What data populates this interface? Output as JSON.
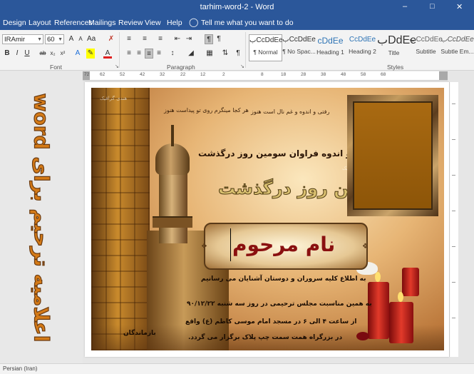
{
  "window": {
    "title": "tarhim-word-2  -  Word"
  },
  "tabs": [
    "Design",
    "Layout",
    "References",
    "Mailings",
    "Review",
    "View",
    "Help"
  ],
  "tell_me": {
    "placeholder": "Tell me what you want to do"
  },
  "font": {
    "name": "IRAmir",
    "size": "60"
  },
  "groups": {
    "font": "Font",
    "paragraph": "Paragraph",
    "styles": "Styles"
  },
  "styles": [
    {
      "preview": "بCcDdEe",
      "name": "¶ Normal"
    },
    {
      "preview": "بCcDdEe",
      "name": "¶ No Spac..."
    },
    {
      "preview": "cDdEe",
      "name": "Heading 1"
    },
    {
      "preview": "CcDdEe",
      "name": "Heading 2"
    },
    {
      "preview": "بDdEe",
      "name": "Title"
    },
    {
      "preview": "بCcDdEe",
      "name": "Subtitle"
    },
    {
      "preview": "بCcDdEe",
      "name": "Subtle Em..."
    }
  ],
  "ruler": {
    "labels": [
      "72",
      "62",
      "52",
      "42",
      "32",
      "22",
      "12",
      "2",
      "8",
      "18",
      "28",
      "38",
      "48",
      "58",
      "68"
    ]
  },
  "sidebar_text": "اعلامیه ترحیم برای word",
  "card": {
    "poem_right": "رفتی و اندوه و غم نال است هنوز",
    "poem_left": "هر کجا مینگرم روی تو پیداست هنوز",
    "line1": "با نهایت تاسف و اندوه فراوان سومین روز درگذشت",
    "headline": "سومین روز درگذشت",
    "name": "نام مرحوم",
    "intro": "به اطلاع کلیه سروران و دوستان آشنایان می رسانیم",
    "body1": "به همین مناسبت مجلس ترحیمی در روز سه شنبه ۹۰/۱۲/۲۲",
    "body2": "از ساعت ۴ الی ۶ در مسجد امام موسی کاظم (ع) واقع",
    "body3": "در بزرگراه همت سمت چپ پلاک برگزار می گردد.",
    "signature": "بازماندگان",
    "watermark": "هندی گرافیک"
  },
  "status": {
    "language": "Persian (Iran)"
  },
  "colors": {
    "accent": "#2b579a",
    "sidebar_text": "#d47a17"
  }
}
